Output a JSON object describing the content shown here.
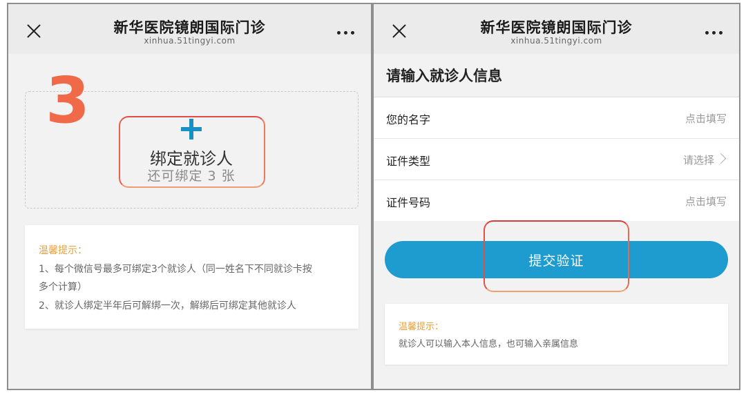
{
  "left": {
    "header": {
      "title": "新华医院镜朗国际门诊",
      "domain": "xinhua.51tingyi.com"
    },
    "step_number": "3",
    "bind_card": {
      "label": "绑定就诊人",
      "sub": "还可绑定 3 张"
    },
    "tips": {
      "title": "温馨提示：",
      "line1a": "1、每个微信号最多可绑定3个就诊人（同一姓名下不同就诊卡按",
      "line1b": "多个计算）",
      "line2": "2、就诊人绑定半年后可解绑一次，解绑后可绑定其他就诊人"
    }
  },
  "right": {
    "header": {
      "title": "新华医院镜朗国际门诊",
      "domain": "xinhua.51tingyi.com"
    },
    "section_title": "请输入就诊人信息",
    "fields": [
      {
        "label": "您的名字",
        "value": "点击填写"
      },
      {
        "label": "证件类型",
        "value": "请选择"
      },
      {
        "label": "证件号码",
        "value": "点击填写"
      }
    ],
    "submit_label": "提交验证",
    "tips": {
      "title": "温馨提示：",
      "line1": "就诊人可以输入本人信息，也可输入亲属信息"
    }
  },
  "colors": {
    "accent_blue": "#1e9bcf",
    "highlight_red": "#e8524a",
    "tips_orange": "#e8a13a",
    "step_number": "#f06a4a"
  },
  "icons": [
    "close-icon",
    "more-icon",
    "plus-icon",
    "chevron-right-icon"
  ]
}
